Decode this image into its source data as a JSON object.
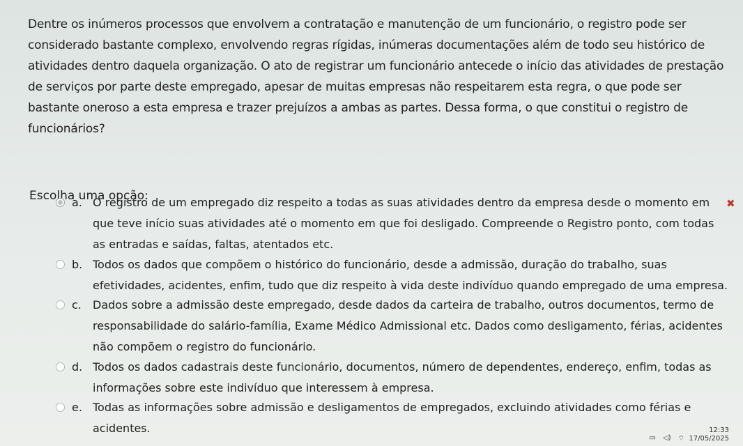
{
  "question": {
    "text": "Dentre os inúmeros processos que envolvem a contratação e manutenção de um funcionário, o registro pode ser considerado bastante complexo, envolvendo regras rígidas, inúmeras documentações além de todo seu histórico de atividades dentro daquela organização. O ato de registrar um funcionário antecede o início das atividades de prestação de serviços por parte deste empregado, apesar de muitas empresas não respeitarem esta regra, o que pode ser bastante oneroso a esta empresa e trazer prejuízos a ambas as partes. Dessa forma, o que constitui o registro de funcionários?"
  },
  "prompt": "Escolha uma opção:",
  "options": [
    {
      "letter": "a.",
      "text": "O registro de um empregado diz respeito a todas as suas atividades dentro da empresa desde o momento em que teve início suas atividades até o momento em que foi desligado. Compreende o Registro ponto, com todas as entradas e saídas, faltas, atentados etc.",
      "selected": true
    },
    {
      "letter": "b.",
      "text": "Todos os dados que compõem o histórico do funcionário, desde a admissão, duração do trabalho, suas efetividades, acidentes, enfim, tudo que diz respeito à vida deste indivíduo quando empregado de uma empresa.",
      "selected": false
    },
    {
      "letter": "c.",
      "text": "Dados sobre a admissão deste empregado, desde dados da carteira de trabalho, outros documentos, termo de responsabilidade do salário-família, Exame Médico Admissional etc. Dados como desligamento, férias, acidentes não compõem o registro do funcionário.",
      "selected": false
    },
    {
      "letter": "d.",
      "text": "Todos os dados cadastrais deste funcionário, documentos, número de dependentes, endereço, enfim, todas as informações sobre este indivíduo que interessem à empresa.",
      "selected": false
    },
    {
      "letter": "e.",
      "text": "Todas as informações sobre admissão e desligamentos de empregados, excluindo atividades como férias e acidentes.",
      "selected": false
    }
  ],
  "feedback": {
    "wrong_icon": "cross-icon",
    "wrong_color": "#c0392b"
  },
  "taskbar": {
    "time": "12:33",
    "date": "17/05/2025"
  }
}
